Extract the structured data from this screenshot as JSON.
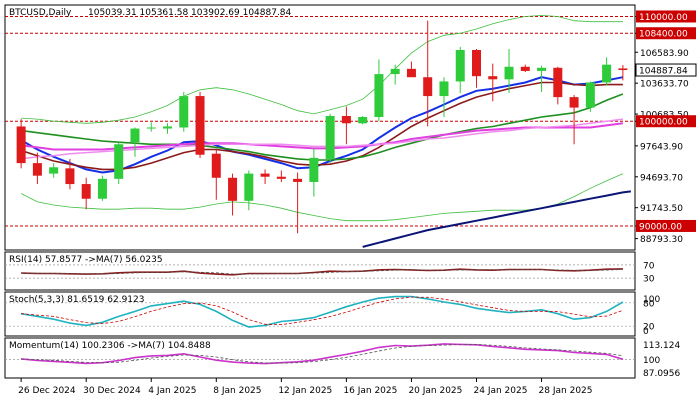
{
  "header": {
    "symbol": "BTCUSD,Daily",
    "ohlc": "105039.31 105361.58 103902.69 104887.84"
  },
  "colors": {
    "background": "#ffffff",
    "frame": "#000000",
    "bull": "#2ecc3a",
    "bear": "#e01b1b",
    "ma_blue": "#1530e6",
    "ma_darkred": "#8b1a1a",
    "ma_green": "#1f8f1f",
    "ma_magenta": "#e040e0",
    "bb_green": "#3fbf3f",
    "trend_navy": "#0b1577",
    "level_red": "#cc0000",
    "rsi_line": "#8b1a1a",
    "stoch_main": "#20b2c0",
    "momentum_line": "#cc33cc"
  },
  "main_chart": {
    "price_labels": [
      "110000.00",
      "108400.00",
      "106583.90",
      "104887.84",
      "103633.70",
      "100683.50",
      "100000.00",
      "97643.90",
      "94693.70",
      "91743.50",
      "90000.00",
      "88793.30"
    ],
    "highlight_labels": {
      "top_level": "110000.00",
      "resistance": "108400.00",
      "current_price": "104887.84",
      "round_level": "100000.00",
      "support": "90000.00"
    }
  },
  "chart_data": {
    "type": "candlestick",
    "x_tick_labels": [
      "26 Dec 2024",
      "30 Dec 2024",
      "4 Jan 2025",
      "8 Jan 2025",
      "12 Jan 2025",
      "16 Jan 2025",
      "20 Jan 2025",
      "24 Jan 2025",
      "28 Jan 2025"
    ],
    "y_range": [
      87800,
      111000
    ],
    "horizontal_levels": [
      110000,
      108400,
      100000,
      90000
    ],
    "candles": [
      {
        "o": 99500,
        "h": 100200,
        "l": 95500,
        "c": 96000
      },
      {
        "o": 96000,
        "h": 97000,
        "l": 94000,
        "c": 94800
      },
      {
        "o": 95000,
        "h": 96000,
        "l": 94600,
        "c": 95600
      },
      {
        "o": 95500,
        "h": 96400,
        "l": 93500,
        "c": 94000
      },
      {
        "o": 94000,
        "h": 94600,
        "l": 91600,
        "c": 92600
      },
      {
        "o": 92600,
        "h": 94800,
        "l": 92400,
        "c": 94500
      },
      {
        "o": 94500,
        "h": 98000,
        "l": 94000,
        "c": 97800
      },
      {
        "o": 98000,
        "h": 99400,
        "l": 96600,
        "c": 99300
      },
      {
        "o": 99300,
        "h": 99900,
        "l": 99000,
        "c": 99400
      },
      {
        "o": 99300,
        "h": 99800,
        "l": 98800,
        "c": 99500
      },
      {
        "o": 99400,
        "h": 102800,
        "l": 99000,
        "c": 102400
      },
      {
        "o": 102400,
        "h": 102800,
        "l": 96500,
        "c": 96800
      },
      {
        "o": 96900,
        "h": 97300,
        "l": 92500,
        "c": 94600
      },
      {
        "o": 94600,
        "h": 95000,
        "l": 91000,
        "c": 92400
      },
      {
        "o": 92400,
        "h": 95300,
        "l": 91500,
        "c": 95000
      },
      {
        "o": 95000,
        "h": 95400,
        "l": 94000,
        "c": 94700
      },
      {
        "o": 94700,
        "h": 95300,
        "l": 94200,
        "c": 94500
      },
      {
        "o": 94500,
        "h": 95100,
        "l": 89300,
        "c": 94200
      },
      {
        "o": 94200,
        "h": 97400,
        "l": 92800,
        "c": 96500
      },
      {
        "o": 96400,
        "h": 100700,
        "l": 96000,
        "c": 100500
      },
      {
        "o": 100500,
        "h": 101400,
        "l": 97800,
        "c": 99800
      },
      {
        "o": 99800,
        "h": 100500,
        "l": 99700,
        "c": 100400
      },
      {
        "o": 100400,
        "h": 105900,
        "l": 100000,
        "c": 104500
      },
      {
        "o": 104500,
        "h": 105400,
        "l": 103500,
        "c": 105000
      },
      {
        "o": 105000,
        "h": 105700,
        "l": 104400,
        "c": 104200
      },
      {
        "o": 104200,
        "h": 109600,
        "l": 99500,
        "c": 102400
      },
      {
        "o": 102400,
        "h": 104200,
        "l": 100400,
        "c": 103800
      },
      {
        "o": 103800,
        "h": 107100,
        "l": 102700,
        "c": 106800
      },
      {
        "o": 106800,
        "h": 106900,
        "l": 103200,
        "c": 104300
      },
      {
        "o": 104300,
        "h": 105500,
        "l": 101900,
        "c": 104000
      },
      {
        "o": 104000,
        "h": 106900,
        "l": 102700,
        "c": 105200
      },
      {
        "o": 105200,
        "h": 105400,
        "l": 104700,
        "c": 104800
      },
      {
        "o": 104800,
        "h": 105300,
        "l": 102800,
        "c": 105100
      },
      {
        "o": 105100,
        "h": 105200,
        "l": 101600,
        "c": 102300
      },
      {
        "o": 102300,
        "h": 102500,
        "l": 97800,
        "c": 101300
      },
      {
        "o": 101300,
        "h": 103800,
        "l": 100900,
        "c": 103700
      },
      {
        "o": 103700,
        "h": 106100,
        "l": 103400,
        "c": 105400
      },
      {
        "o": 105039.31,
        "h": 105361.58,
        "l": 103902.69,
        "c": 104887.84
      }
    ],
    "overlays": [
      {
        "name": "blue_ma",
        "values": [
          98200,
          97300,
          96600,
          96000,
          95400,
          95100,
          95300,
          95900,
          96600,
          97200,
          98000,
          98100,
          97700,
          97100,
          96800,
          96400,
          96000,
          95500,
          95600,
          96200,
          96700,
          97300,
          98400,
          99400,
          100300,
          100900,
          101600,
          102300,
          102900,
          103100,
          103400,
          103700,
          104200,
          103900,
          103500,
          103600,
          103900,
          104200
        ]
      },
      {
        "name": "darkred_ma",
        "values": [
          97200,
          96700,
          96200,
          95900,
          95600,
          95400,
          95400,
          95600,
          96000,
          96500,
          97000,
          97300,
          97300,
          97100,
          96900,
          96600,
          96200,
          95900,
          95800,
          95900,
          96200,
          96700,
          97500,
          98500,
          99500,
          100300,
          101000,
          101700,
          102300,
          102700,
          103100,
          103400,
          103700,
          103700,
          103500,
          103400,
          103500,
          103500
        ]
      },
      {
        "name": "green_ma",
        "values": [
          99100,
          98900,
          98700,
          98500,
          98300,
          98100,
          98000,
          97900,
          97800,
          97800,
          97800,
          97700,
          97500,
          97300,
          97100,
          96800,
          96600,
          96400,
          96300,
          96300,
          96400,
          96600,
          97000,
          97500,
          97900,
          98300,
          98700,
          99000,
          99300,
          99500,
          99800,
          100100,
          100400,
          100600,
          100800,
          101300,
          102000,
          102600
        ]
      },
      {
        "name": "magenta_ma",
        "values": [
          97700,
          97500,
          97300,
          97300,
          97300,
          97300,
          97400,
          97500,
          97600,
          97700,
          97800,
          97900,
          97900,
          97900,
          97800,
          97700,
          97600,
          97500,
          97400,
          97400,
          97500,
          97600,
          97800,
          98000,
          98300,
          98500,
          98700,
          98900,
          99100,
          99200,
          99300,
          99400,
          99400,
          99400,
          99400,
          99400,
          99600,
          99800
        ]
      },
      {
        "name": "pink_ma",
        "values": [
          96400,
          96600,
          96700,
          96900,
          97000,
          97100,
          97200,
          97300,
          97400,
          97500,
          97600,
          97700,
          97800,
          97800,
          97800,
          97800,
          97800,
          97700,
          97600,
          97600,
          97600,
          97700,
          97800,
          97900,
          98100,
          98300,
          98400,
          98600,
          98800,
          99000,
          99100,
          99300,
          99400,
          99500,
          99600,
          99800,
          100000,
          100200
        ]
      },
      {
        "name": "bb_upper",
        "values": [
          100300,
          100200,
          100000,
          99900,
          99800,
          99900,
          100100,
          100400,
          100900,
          101500,
          102400,
          103000,
          103200,
          103000,
          102600,
          102100,
          101600,
          101000,
          100700,
          101100,
          101500,
          102100,
          103400,
          105000,
          106500,
          107600,
          108200,
          108400,
          108800,
          109300,
          109700,
          110000,
          110100,
          110000,
          109600,
          109500,
          109500,
          109500
        ]
      },
      {
        "name": "bb_lower",
        "values": [
          93100,
          92300,
          92000,
          91800,
          91700,
          91600,
          91600,
          91700,
          91700,
          91600,
          91600,
          91800,
          92100,
          92300,
          92200,
          92000,
          91700,
          91300,
          91000,
          90700,
          90500,
          90500,
          90500,
          90600,
          90800,
          91000,
          91200,
          91300,
          91400,
          91500,
          91500,
          91500,
          91700,
          92100,
          92800,
          93600,
          94300,
          95000
        ]
      },
      {
        "name": "trendline",
        "values": [
          null,
          null,
          null,
          null,
          null,
          null,
          null,
          null,
          null,
          null,
          null,
          null,
          null,
          null,
          null,
          null,
          null,
          null,
          null,
          null,
          null,
          88000,
          88400,
          88800,
          89200,
          89600,
          89900,
          90200,
          90500,
          90800,
          91100,
          91400,
          91700,
          92000,
          92300,
          92600,
          92900,
          93200
        ]
      }
    ],
    "rsi": {
      "label": "RSI(14) 57.8577 ->MA(7) 56.0235",
      "range": [
        0,
        100
      ],
      "levels": [
        30,
        70
      ],
      "tick_labels": [
        "70",
        "30"
      ],
      "values": [
        45,
        44,
        44,
        43,
        42,
        43,
        46,
        48,
        48,
        48,
        51,
        45,
        42,
        40,
        44,
        44,
        44,
        44,
        47,
        51,
        50,
        51,
        55,
        56,
        55,
        53,
        54,
        57,
        55,
        54,
        56,
        56,
        56,
        53,
        52,
        54,
        57,
        58
      ]
    },
    "stochastic": {
      "label": "Stoch(5,3,3) 81.6519 62.9123",
      "range": [
        0,
        100
      ],
      "levels": [
        20,
        80
      ],
      "tick_labels": [
        "100",
        "80",
        "20",
        "0"
      ],
      "values": [
        52,
        45,
        38,
        28,
        22,
        30,
        45,
        58,
        72,
        78,
        84,
        76,
        58,
        35,
        18,
        22,
        32,
        36,
        42,
        56,
        70,
        82,
        92,
        96,
        96,
        90,
        82,
        76,
        66,
        60,
        55,
        58,
        62,
        52,
        38,
        42,
        58,
        82
      ]
    },
    "momentum": {
      "label": "Momentum(14) 100.2306 ->MA(7) 104.8488",
      "range": [
        87.0956,
        114.5
      ],
      "levels": [
        100
      ],
      "tick_labels": [
        "113.124",
        "100",
        "87.0956"
      ],
      "values": [
        100.5,
        99.2,
        98.5,
        97.8,
        97.0,
        97.5,
        99.2,
        101.5,
        102.8,
        103.2,
        104.5,
        102.0,
        99.5,
        98.0,
        97.2,
        96.8,
        97.5,
        98.2,
        99.5,
        101.8,
        104.0,
        106.5,
        109.5,
        111.0,
        110.5,
        111.2,
        112.2,
        111.8,
        111.5,
        110.2,
        109.2,
        108.0,
        107.5,
        107.0,
        105.5,
        104.8,
        104.0,
        100.2
      ]
    }
  }
}
